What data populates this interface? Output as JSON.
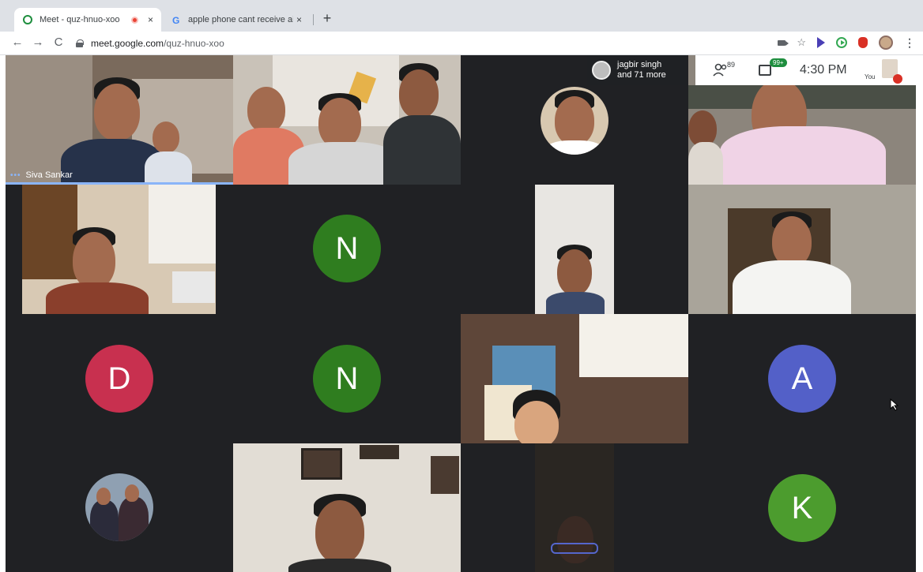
{
  "browser": {
    "tabs": [
      {
        "title": "Meet - quz-hnuo-xoo",
        "active": true,
        "recording": true
      },
      {
        "title": "apple phone cant receive airdr",
        "active": false
      }
    ],
    "close_glyph": "×",
    "new_tab_glyph": "+",
    "nav": {
      "back": "←",
      "forward": "→",
      "reload": "C"
    },
    "url": {
      "host": "meet.google.com",
      "path": "/quz-hnuo-xoo"
    },
    "star_glyph": "☆",
    "menu_glyph": "⋮"
  },
  "meet": {
    "joined": {
      "line1": "jagbir singh",
      "line2": "and 71 more"
    },
    "people_count": "89",
    "chat_badge": "99+",
    "clock": "4:30 PM",
    "you_label": "You",
    "tiles": {
      "siva": {
        "name": "Siva Sankar",
        "dots": "•••"
      },
      "n1": {
        "letter": "N",
        "color": "#2f7d1f"
      },
      "n2": {
        "letter": "N",
        "color": "#2f7d1f"
      },
      "d": {
        "letter": "D",
        "color": "#c8304f"
      },
      "a": {
        "letter": "A",
        "color": "#5360c8"
      },
      "k": {
        "letter": "K",
        "color": "#4c9c2e"
      }
    }
  }
}
